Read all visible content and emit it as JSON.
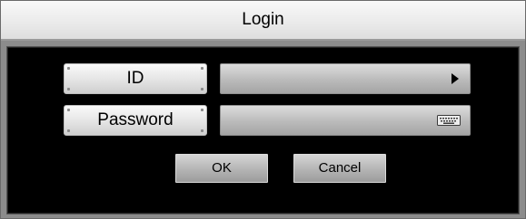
{
  "dialog": {
    "title": "Login"
  },
  "form": {
    "id_label": "ID",
    "id_value": "",
    "id_icon": "dropdown-arrow-icon",
    "password_label": "Password",
    "password_value": "",
    "password_icon": "keyboard-icon"
  },
  "buttons": {
    "ok_label": "OK",
    "cancel_label": "Cancel"
  },
  "colors": {
    "panel_background": "#000000",
    "frame": "#8c8c8c"
  }
}
